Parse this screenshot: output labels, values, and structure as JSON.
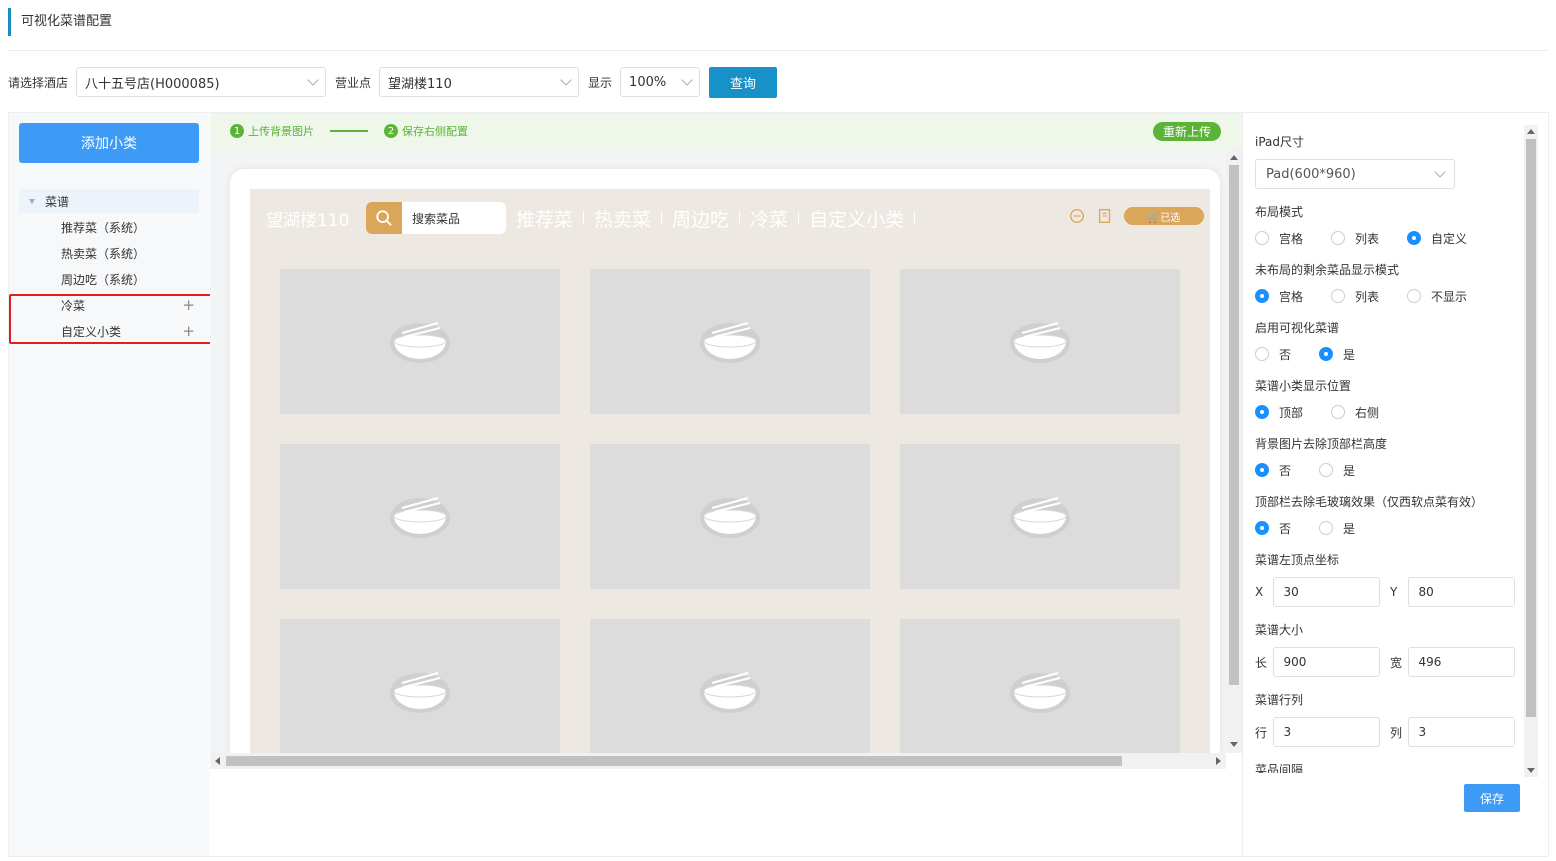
{
  "page_title": "可视化菜谱配置",
  "filters": {
    "hotel_label": "请选择酒店",
    "hotel_value": "八十五号店(H000085)",
    "outlet_label": "营业点",
    "outlet_value": "望湖楼110",
    "display_label": "显示",
    "display_value": "100%",
    "query_button": "查询"
  },
  "left_panel": {
    "add_button": "添加小类",
    "tree_root": "菜谱",
    "items": [
      {
        "label": "推荐菜（系统）",
        "plus": ""
      },
      {
        "label": "热卖菜（系统）",
        "plus": ""
      },
      {
        "label": "周边吃（系统）",
        "plus": ""
      },
      {
        "label": "冷菜",
        "plus": "+"
      },
      {
        "label": "自定义小类",
        "plus": "+"
      }
    ]
  },
  "steps": {
    "step1_num": "1",
    "step1": "上传背景图片",
    "step2_num": "2",
    "step2": "保存右侧配置",
    "reupload": "重新上传"
  },
  "preview": {
    "store_name": "望湖楼110",
    "search_placeholder": "搜索菜品",
    "categories": [
      "推荐菜",
      "热卖菜",
      "周边吃",
      "冷菜",
      "自定义小类"
    ],
    "cart_label": "🛒已选",
    "rows": 3,
    "cols": 3
  },
  "right_panel": {
    "ipad_size_label": "iPad尺寸",
    "ipad_size_value": "Pad(600*960)",
    "layout_mode_label": "布局模式",
    "layout_mode_options": [
      "宫格",
      "列表",
      "自定义"
    ],
    "layout_mode_selected": "自定义",
    "remaining_label": "未布局的剩余菜品显示模式",
    "remaining_options": [
      "宫格",
      "列表",
      "不显示"
    ],
    "remaining_selected": "宫格",
    "enable_label": "启用可视化菜谱",
    "enable_options": [
      "否",
      "是"
    ],
    "enable_selected": "是",
    "subcat_pos_label": "菜谱小类显示位置",
    "subcat_pos_options": [
      "顶部",
      "右侧"
    ],
    "subcat_pos_selected": "顶部",
    "bg_remove_label": "背景图片去除顶部栏高度",
    "bg_remove_options": [
      "否",
      "是"
    ],
    "bg_remove_selected": "否",
    "glass_label": "顶部栏去除毛玻璃效果（仅西软点菜有效）",
    "glass_options": [
      "否",
      "是"
    ],
    "glass_selected": "否",
    "coord_label": "菜谱左顶点坐标",
    "x_label": "X",
    "x_value": "30",
    "y_label": "Y",
    "y_value": "80",
    "size_label": "菜谱大小",
    "len_label": "长",
    "len_value": "900",
    "width_label": "宽",
    "width_value": "496",
    "grid_label": "菜谱行列",
    "row_label": "行",
    "row_value": "3",
    "col_label": "列",
    "col_value": "3",
    "spacing_label": "菜品间隔",
    "save_button": "保存"
  },
  "colors": {
    "primary": "#3d9bf5",
    "query": "#1890c8",
    "step_green": "#5bb337",
    "highlight_red": "#e02020",
    "preview_accent": "#d9a65a"
  }
}
